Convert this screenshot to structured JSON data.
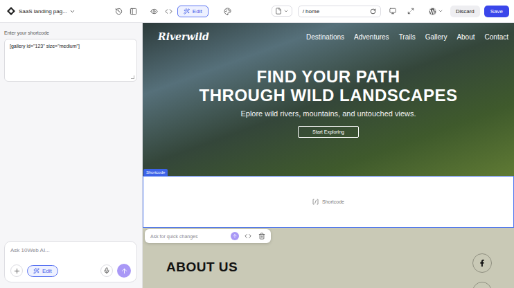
{
  "topbar": {
    "project": "SaaS landing pag...",
    "edit": {
      "label": "Edit",
      "selected": true
    },
    "path": "/ home",
    "discard": "Discard",
    "save": "Save"
  },
  "sidebar": {
    "label": "Enter your shortcode",
    "value": "[gallery id=\"123\" size=\"medium\"]",
    "chat": {
      "placeholder": "Ask 10Web AI...",
      "mode": {
        "label": "Edit",
        "selected": true
      }
    }
  },
  "site": {
    "logo": "Riverwild",
    "nav": [
      "Destinations",
      "Adventures",
      "Trails",
      "Gallery",
      "About",
      "Contact"
    ],
    "hero": {
      "title": [
        "FIND YOUR PATH",
        "THROUGH WILD LANDSCAPES"
      ],
      "subtitle": "Eplore wild rivers, mountains, and untouched views.",
      "button": "Start Exploring"
    },
    "shortcode": {
      "tag": "Shortcode",
      "placeholder": "Shortcode",
      "selected": true
    },
    "quick_edit": {
      "placeholder": "Ask for quick changes"
    },
    "about": {
      "title": "ABOUT US"
    }
  }
}
